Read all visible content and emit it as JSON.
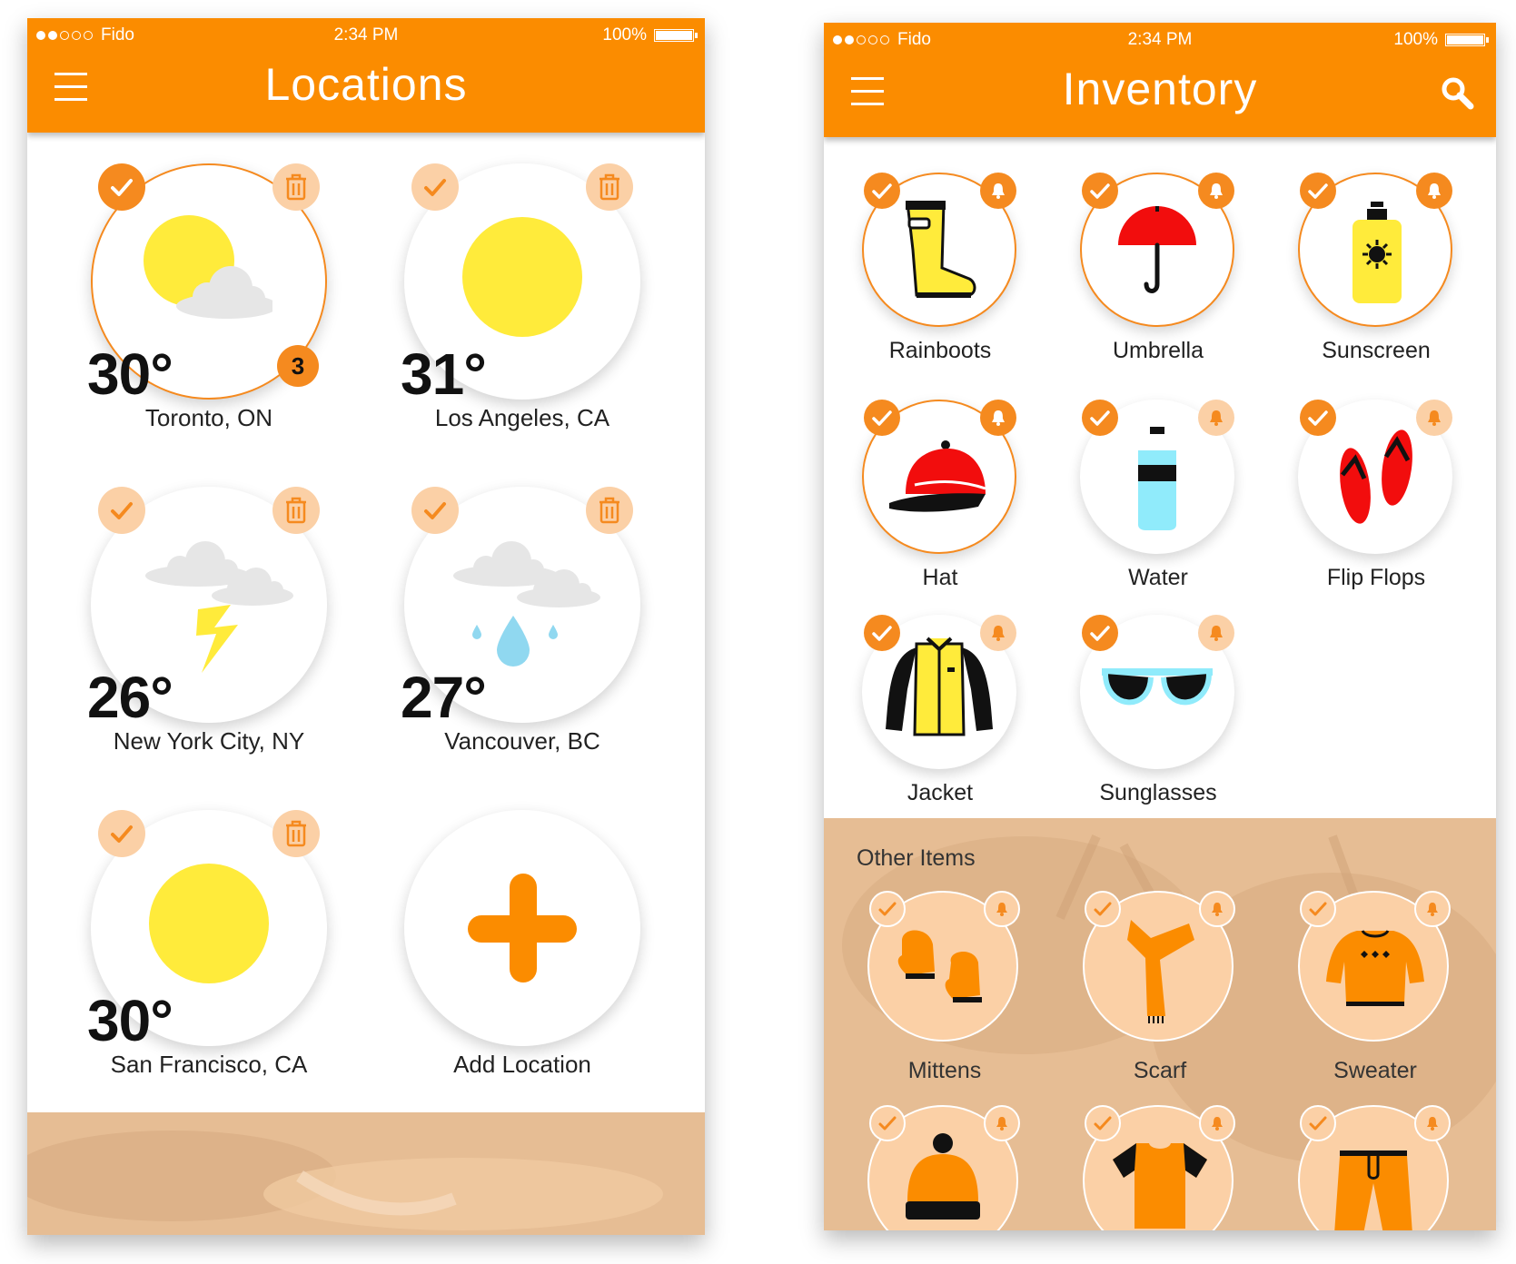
{
  "status": {
    "carrier": "Fido",
    "time": "2:34 PM",
    "battery": "100%"
  },
  "locations_screen": {
    "title": "Locations",
    "tiles": [
      {
        "temp": "30°",
        "name": "Toronto, ON",
        "weather": "sun-behind-cloud-icon",
        "selected": true,
        "count": "3"
      },
      {
        "temp": "31°",
        "name": "Los Angeles, CA",
        "weather": "sun-icon",
        "selected": false
      },
      {
        "temp": "26°",
        "name": "New York City, NY",
        "weather": "thunderstorm-icon",
        "selected": false
      },
      {
        "temp": "27°",
        "name": "Vancouver, BC",
        "weather": "rain-icon",
        "selected": false
      },
      {
        "temp": "30°",
        "name": "San Francisco, CA",
        "weather": "sun-icon",
        "selected": false
      }
    ],
    "add_label": "Add Location"
  },
  "inventory_screen": {
    "title": "Inventory",
    "items": [
      {
        "name": "Rainboots",
        "icon": "rainboots-icon",
        "active": true,
        "bell": true
      },
      {
        "name": "Umbrella",
        "icon": "umbrella-icon",
        "active": true,
        "bell": true
      },
      {
        "name": "Sunscreen",
        "icon": "sunscreen-icon",
        "active": true,
        "bell": true
      },
      {
        "name": "Hat",
        "icon": "cap-icon",
        "active": true,
        "bell": true
      },
      {
        "name": "Water",
        "icon": "water-bottle-icon",
        "active": false,
        "bell": false
      },
      {
        "name": "Flip Flops",
        "icon": "flip-flops-icon",
        "active": false,
        "bell": false
      },
      {
        "name": "Jacket",
        "icon": "jacket-icon",
        "active": false,
        "bell": false
      },
      {
        "name": "Sunglasses",
        "icon": "sunglasses-icon",
        "active": false,
        "bell": false
      }
    ],
    "other_title": "Other Items",
    "other_items": [
      {
        "name": "Mittens",
        "icon": "mittens-icon"
      },
      {
        "name": "Scarf",
        "icon": "scarf-icon"
      },
      {
        "name": "Sweater",
        "icon": "sweater-icon"
      },
      {
        "name": "",
        "icon": "toque-icon"
      },
      {
        "name": "",
        "icon": "t-shirt-icon"
      },
      {
        "name": "",
        "icon": "pants-icon"
      }
    ]
  },
  "colors": {
    "accent": "#fb8c00",
    "accent_light": "#fbd0a6",
    "sun": "#ffeb3b",
    "red": "#f20d0d"
  }
}
